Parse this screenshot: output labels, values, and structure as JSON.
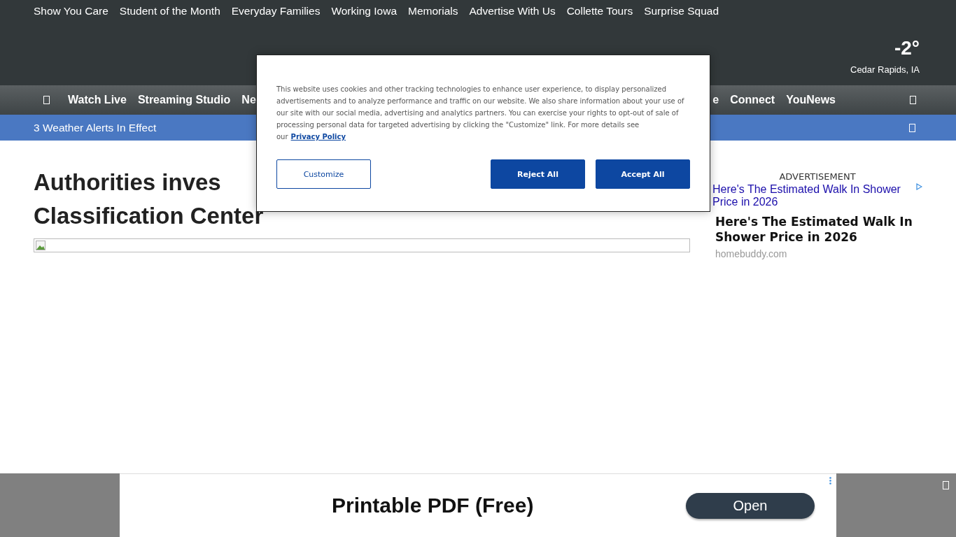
{
  "top_links": [
    "Show You Care",
    "Student of the Month",
    "Everyday Families",
    "Working Iowa",
    "Memorials",
    "Advertise With Us",
    "Collette Tours",
    "Surprise Squad"
  ],
  "weather": {
    "temperature": "-2°",
    "location": "Cedar Rapids, IA"
  },
  "nav": {
    "left": [
      "Watch Live",
      "Streaming Studio",
      "Ne"
    ],
    "right": [
      "e",
      "Connect",
      "YouNews"
    ]
  },
  "alert_bar": {
    "text": "3 Weather Alerts In Effect"
  },
  "headline": [
    "Authorities inves",
    "Classification Center"
  ],
  "sidebar_ad": {
    "label": "ADVERTISEMENT",
    "image_alt": "Here's The Estimated Walk In Shower Price in 2026",
    "title": "Here's The Estimated Walk In Shower Price in 2026",
    "source": "homebuddy.com"
  },
  "cookie_dialog": {
    "text": "This website uses cookies and other tracking technologies to enhance user experience, to display personalized advertisements and to analyze performance and traffic on our website. We also share information about your use of our site with our social media, advertising and analytics partners. You can exercise your rights to opt-out of sale of processing personal data for targeted advertising by clicking the \"Customize\" link. For more details see our",
    "link": "Privacy Policy",
    "buttons": [
      {
        "label": "Customize",
        "kind": "outline"
      },
      {
        "label": "Reject All",
        "kind": "filled"
      },
      {
        "label": "Accept All",
        "kind": "filled"
      }
    ]
  },
  "bottom_ad": {
    "title": "Printable PDF (Free)",
    "button": "Open"
  }
}
